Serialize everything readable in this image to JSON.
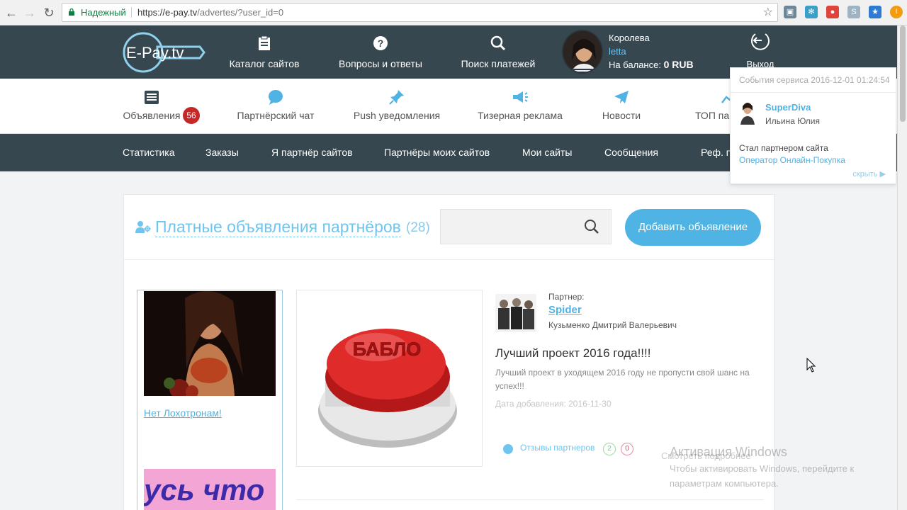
{
  "browser": {
    "secure_label": "Надежный",
    "url_host": "https://e-pay.tv",
    "url_path": "/advertes/?user_id=0"
  },
  "header": {
    "logo_text": "E-Pay.tv",
    "items": [
      {
        "label": "Каталог сайтов",
        "icon": "clipboard-icon"
      },
      {
        "label": "Вопросы и ответы",
        "icon": "question-icon"
      },
      {
        "label": "Поиск платежей",
        "icon": "search-icon"
      }
    ],
    "user": {
      "name": "Королева",
      "login": "letta",
      "balance_label": "На балансе:",
      "balance_value": "0 RUB"
    },
    "logout_label": "Выход"
  },
  "subnav": {
    "items": [
      {
        "label": "Объявления",
        "icon": "ads-icon"
      },
      {
        "label": "Партнёрский чат",
        "icon": "chat-icon"
      },
      {
        "label": "Push уведомления",
        "icon": "pin-icon"
      },
      {
        "label": "Тизерная реклама",
        "icon": "megaphone-icon"
      },
      {
        "label": "Новости",
        "icon": "paper-plane-icon"
      },
      {
        "label": "ТОП пар",
        "icon": "chart-icon"
      }
    ],
    "ads_badge": "56"
  },
  "menubar": {
    "items": [
      "Статистика",
      "Заказы",
      "Я партнёр сайтов",
      "Партнёры моих сайтов",
      "Мои сайты",
      "Сообщения",
      "Реф. п"
    ]
  },
  "main": {
    "title": "Платные объявления партнёров",
    "count": "(28)",
    "search_placeholder": "",
    "add_button": "Добавить объявление",
    "sidebar": {
      "link_text": "Нет Лохотронам!",
      "banner_text": "усь что"
    },
    "ad": {
      "image_text": "БАБЛО",
      "partner_label": "Партнер:",
      "partner_name": "Spider",
      "partner_full_name": "Кузьменко Дмитрий Валерьевич",
      "title": "Лучший проект 2016 года!!!!",
      "description": "Лучший проект в уходящем 2016 году не пропусти свой шанс на успех!!!",
      "date_text": "Дата добавления: 2016-11-30",
      "reviews_label": "Отзывы партнеров",
      "reviews_positive": "2",
      "reviews_negative": "0"
    }
  },
  "notification": {
    "header": "События сервиса 2016-12-01 01:24:54",
    "user": "SuperDiva",
    "real_name": "Ильина Юлия",
    "text": "Стал партнером сайта",
    "site": "Оператор Онлайн-Покупка",
    "hide_label": "скрыть ▶"
  },
  "watermark": {
    "more_link": "Смотреть подробнее",
    "title": "Активация Windows",
    "line1": "Чтобы активировать Windows, перейдите к",
    "line2": "параметрам компьютера."
  },
  "colors": {
    "header_bg": "#37474f",
    "accent": "#4fb3e3",
    "badge": "#c62828"
  }
}
